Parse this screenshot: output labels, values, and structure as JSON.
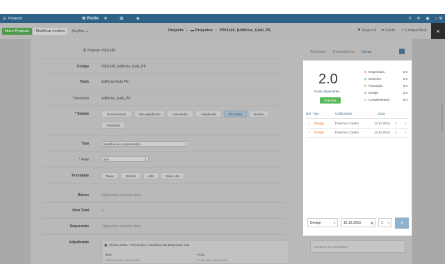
{
  "app": {
    "menu_label": "Projecto",
    "logo_text": "Podio",
    "notifications_count": "78"
  },
  "toolbar": {
    "new_project": "Novo Projecto",
    "modify_model": "Modificar modelo",
    "actions": "Acções",
    "breadcrumb": [
      "Projecto",
      "Projectos",
      "P001149_Edificios_Gubi_PE"
    ],
    "follow": "Seguir",
    "follow_count": "8",
    "like": "Gosto",
    "share": "Compartilhar",
    "close": "×"
  },
  "form": {
    "id_label": "ID Projecto",
    "id_value": "P001149",
    "code_label": "Código",
    "code_value": "P001149_Edificios_Gubi_PE",
    "title_label": "Título",
    "title_value": "Edifícios Gubi PE",
    "description_label": "* Descritivo",
    "description_value": "Edifícios_Gubi_PE",
    "status_label": "* Estado",
    "status_options": [
      "Encaminhado",
      "Não adjudicado",
      "Cancelado",
      "Adjudicado",
      "Em curso",
      "Revisto",
      "Arquivado"
    ],
    "type_label": "Tipo",
    "type_value": "Medidas de Autoprotecção",
    "phase_label": "* Fase",
    "phase_value": "N/A",
    "priority_label": "Prioridade",
    "priority_options": [
      "Baixa",
      "Normal",
      "Alta",
      "Muito Alta"
    ],
    "risks_label": "Riscos",
    "risks_placeholder": "Digite para procurar itens",
    "area_label": "Área Total",
    "area_value": "—",
    "requester_label": "Requerente",
    "requester_placeholder": "Digite para procurar itens",
    "awarded_label": "Adjudicante",
    "contact_name": "Clínica Joliva - Prevenção e Medicina nas Empresas, Lda.",
    "contact_col1": "SMS",
    "contact_col1_value": "Telefone não configurado",
    "contact_col2": "Posto",
    "contact_col2_value": "Email não configurado"
  },
  "side_panel": {
    "tabs": [
      "Atividade",
      "Comentários",
      "Horas"
    ],
    "comment_placeholder": "Adicionar um comentário"
  },
  "hours_popup": {
    "total": "2.0",
    "total_label": "horas dispendidas",
    "export_label": "Exportar",
    "legend": [
      {
        "name": "Engenharia",
        "value": "0.0",
        "color": "#e8a0b4"
      },
      {
        "name": "Desenho",
        "value": "0.0",
        "color": "#9cc4e4"
      },
      {
        "name": "Formação",
        "value": "0.0",
        "color": "#f0b27a"
      },
      {
        "name": "Design",
        "value": "2.0",
        "color": "#c39bd3"
      },
      {
        "name": "Complementos",
        "value": "0.0",
        "color": "#a9dfbf"
      }
    ],
    "columns": [
      "Del.",
      "Tipo",
      "Colaborador",
      "Data"
    ],
    "rows": [
      {
        "marker": "!",
        "type": "Design",
        "worker": "Francisco Castro",
        "date": "14.12.2016",
        "count": "1",
        "remove": "×"
      },
      {
        "marker": "!",
        "type": "Design",
        "worker": "Francisco Castro",
        "date": "14.12.2016",
        "count": "1",
        "remove": "×"
      }
    ],
    "new_type": "Design",
    "new_date": "16.12.2016",
    "new_count": "1",
    "add_label": "+"
  }
}
